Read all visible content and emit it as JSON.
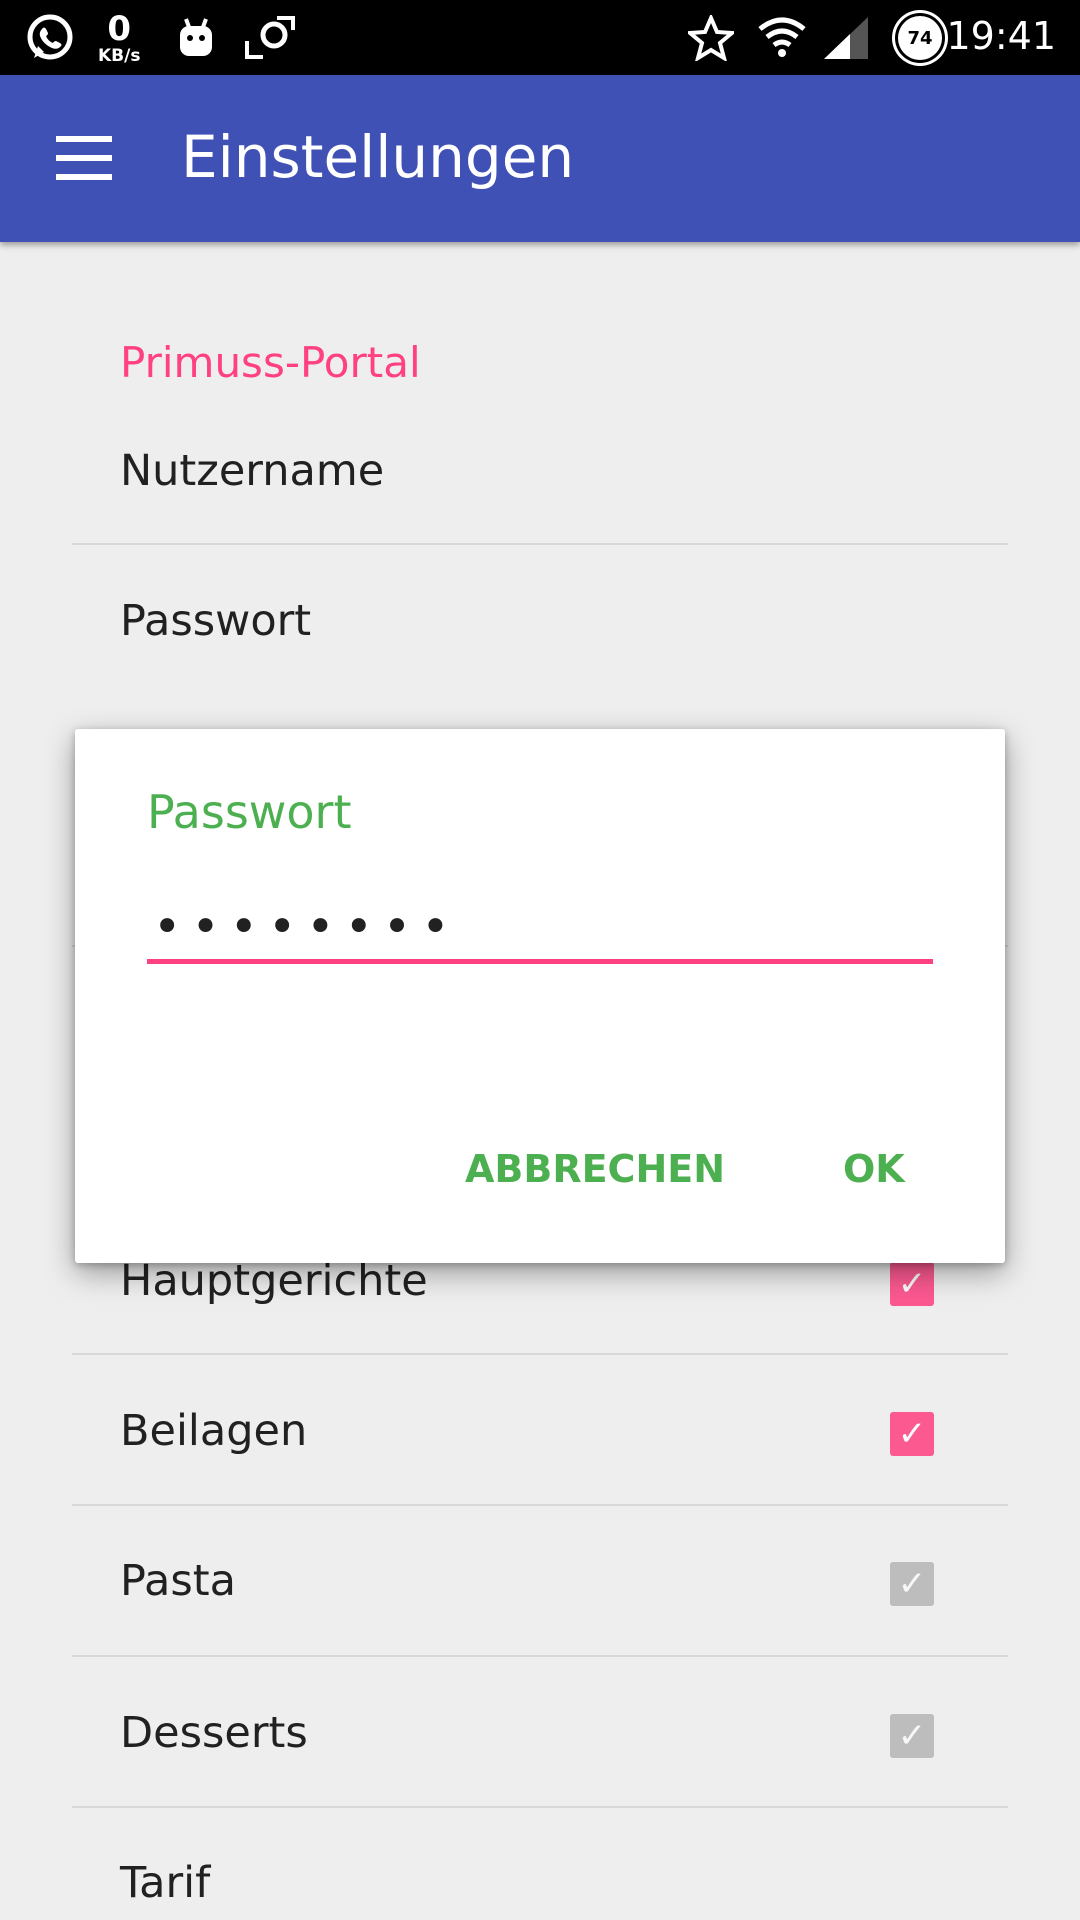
{
  "status_bar": {
    "kb_value": "0",
    "kb_unit": "KB/s",
    "battery": "74",
    "time": "19:41",
    "icons": [
      "whatsapp-icon",
      "android-icon",
      "screenshot-icon",
      "star-icon",
      "wifi-icon",
      "signal-icon",
      "battery-icon"
    ]
  },
  "app_bar": {
    "title": "Einstellungen",
    "color": "#3f51b5"
  },
  "preferences": {
    "category": "Primuss-Portal",
    "category_color": "#ff4081",
    "items": [
      {
        "label": "Nutzername"
      },
      {
        "label": "Passwort"
      },
      {
        "label": "Hauptgerichte",
        "checked": true
      },
      {
        "label": "Beilagen",
        "checked": true
      },
      {
        "label": "Pasta",
        "checked": false
      },
      {
        "label": "Desserts",
        "checked": false
      },
      {
        "label": "Tarif"
      }
    ]
  },
  "dialog": {
    "title": "Passwort",
    "password_value": "••••••••",
    "cancel_label": "ABBRECHEN",
    "ok_label": "OK",
    "accent_color": "#4caf50"
  }
}
